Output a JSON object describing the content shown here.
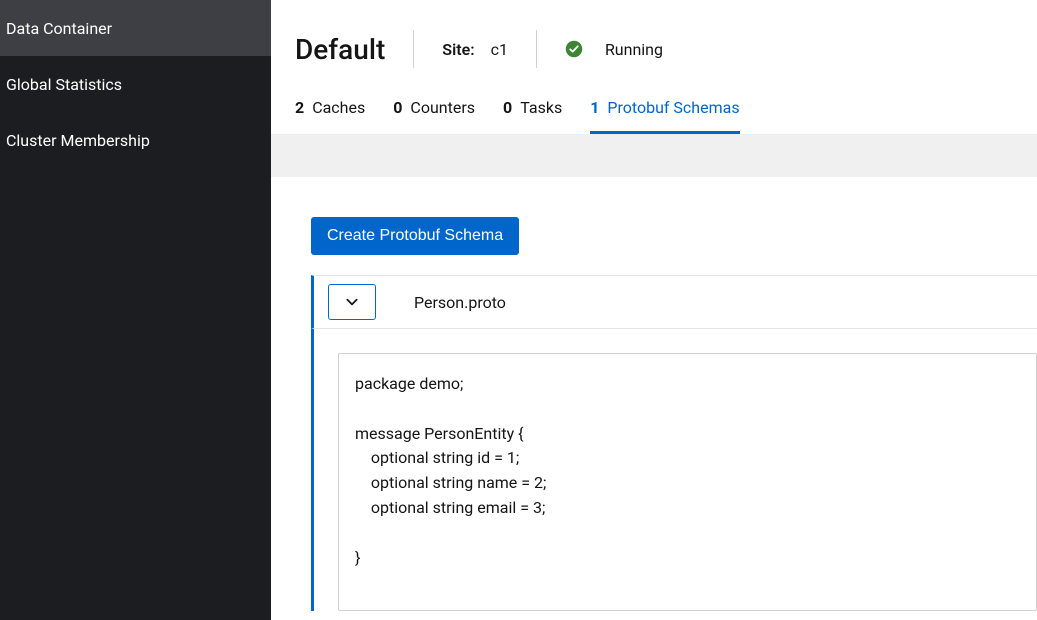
{
  "sidebar": {
    "items": [
      {
        "label": "Data Container",
        "active": true
      },
      {
        "label": "Global Statistics",
        "active": false
      },
      {
        "label": "Cluster Membership",
        "active": false
      }
    ]
  },
  "header": {
    "title": "Default",
    "site_label": "Site:",
    "site_value": "c1",
    "status_text": "Running",
    "status_color": "#3e8635"
  },
  "tabs": [
    {
      "count": "2",
      "label": "Caches",
      "active": false
    },
    {
      "count": "0",
      "label": "Counters",
      "active": false
    },
    {
      "count": "0",
      "label": "Tasks",
      "active": false
    },
    {
      "count": "1",
      "label": "Protobuf Schemas",
      "active": true
    }
  ],
  "actions": {
    "create_label": "Create Protobuf Schema"
  },
  "schema": {
    "name": "Person.proto",
    "code": "package demo;\n\nmessage PersonEntity {\n    optional string id = 1;\n    optional string name = 2;\n    optional string email = 3;\n\n}"
  }
}
